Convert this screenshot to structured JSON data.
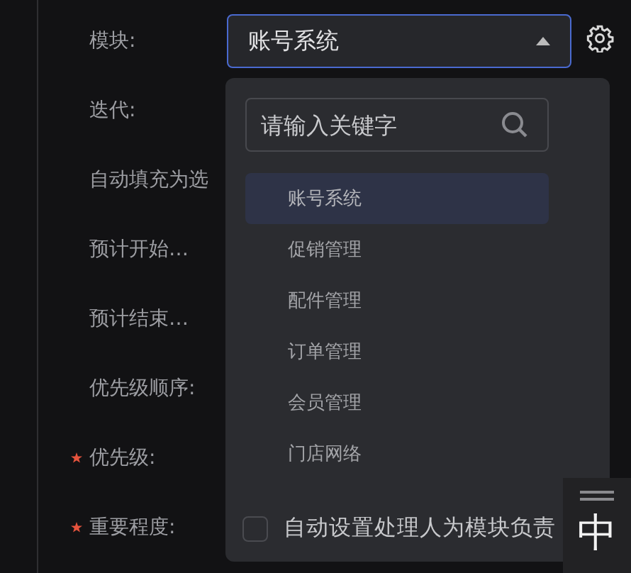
{
  "form": {
    "fields": [
      {
        "label": "模块:",
        "required": false
      },
      {
        "label": "迭代:",
        "required": false
      },
      {
        "label": "自动填充为选",
        "required": false
      },
      {
        "label": "预计开始…",
        "required": false
      },
      {
        "label": "预计结束…",
        "required": false
      },
      {
        "label": "优先级顺序:",
        "required": false
      },
      {
        "label": "优先级:",
        "required": true
      },
      {
        "label": "重要程度:",
        "required": true
      }
    ],
    "module_select": {
      "value": "账号系统",
      "expanded": true
    }
  },
  "dropdown": {
    "search": {
      "placeholder": "请输入关键字"
    },
    "options": [
      {
        "label": "账号系统",
        "selected": true
      },
      {
        "label": "促销管理",
        "selected": false
      },
      {
        "label": "配件管理",
        "selected": false
      },
      {
        "label": "订单管理",
        "selected": false
      },
      {
        "label": "会员管理",
        "selected": false
      },
      {
        "label": "门店网络",
        "selected": false
      }
    ],
    "auto_assign": {
      "label": "自动设置处理人为模块负责",
      "checked": false
    }
  },
  "ime_indicator": {
    "mode": "中"
  }
}
